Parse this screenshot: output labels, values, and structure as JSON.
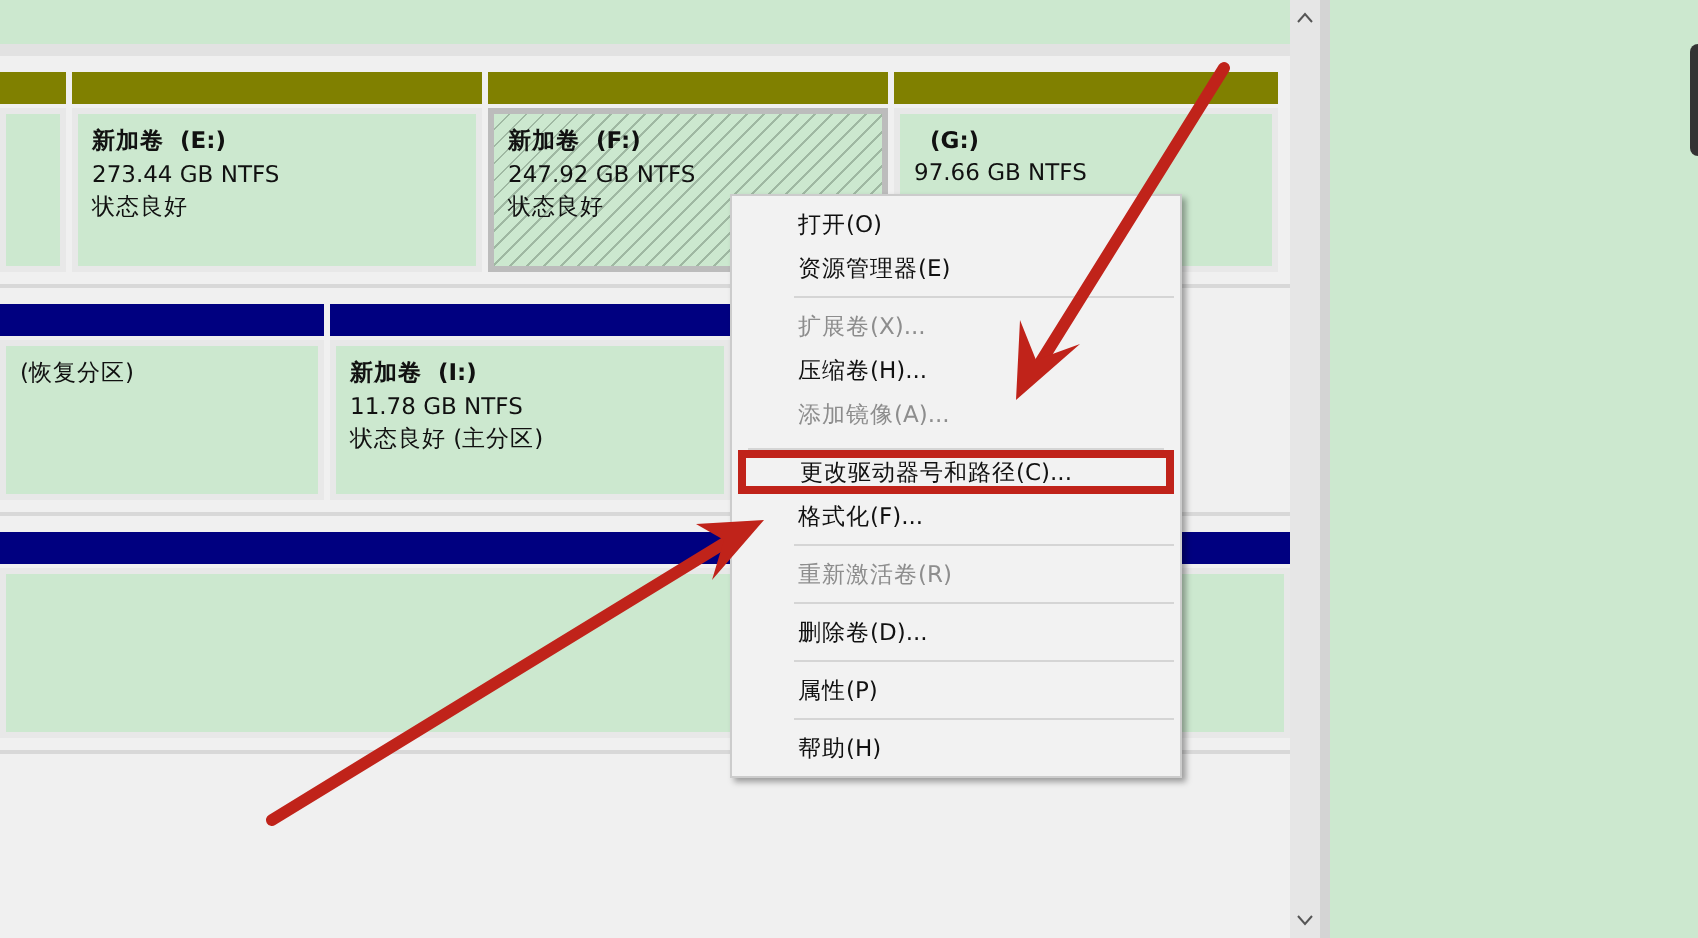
{
  "disks": [
    {
      "partitions": [
        {
          "kind": "logical",
          "selected": false
        },
        {
          "kind": "logical",
          "selected": false,
          "name": "新加卷  (E:)",
          "size": "273.44 GB NTFS",
          "status": "状态良好"
        },
        {
          "kind": "logical",
          "selected": true,
          "name": "新加卷  (F:)",
          "size": "247.92 GB NTFS",
          "status": "状态良好"
        },
        {
          "kind": "logical",
          "selected": false,
          "name": "  (G:)",
          "size": "97.66 GB NTFS"
        }
      ]
    },
    {
      "partitions": [
        {
          "kind": "primary",
          "selected": false,
          "status": "(恢复分区)"
        },
        {
          "kind": "primary",
          "selected": false,
          "name": "新加卷  (I:)",
          "size": "11.78 GB NTFS",
          "status": "状态良好 (主分区)"
        }
      ]
    },
    {
      "partitions": [
        {
          "kind": "primary",
          "selected": false
        }
      ]
    }
  ],
  "context_menu": [
    {
      "label": "打开(O)",
      "disabled": false,
      "separator_before": false,
      "highlighted": false
    },
    {
      "label": "资源管理器(E)",
      "disabled": false,
      "separator_before": false,
      "highlighted": false
    },
    {
      "label": "扩展卷(X)...",
      "disabled": true,
      "separator_before": true,
      "highlighted": false
    },
    {
      "label": "压缩卷(H)...",
      "disabled": false,
      "separator_before": false,
      "highlighted": false
    },
    {
      "label": "添加镜像(A)...",
      "disabled": true,
      "separator_before": false,
      "highlighted": false
    },
    {
      "label": "更改驱动器号和路径(C)...",
      "disabled": false,
      "separator_before": true,
      "highlighted": true
    },
    {
      "label": "格式化(F)...",
      "disabled": false,
      "separator_before": false,
      "highlighted": false
    },
    {
      "label": "重新激活卷(R)",
      "disabled": true,
      "separator_before": true,
      "highlighted": false
    },
    {
      "label": "删除卷(D)...",
      "disabled": false,
      "separator_before": true,
      "highlighted": false
    },
    {
      "label": "属性(P)",
      "disabled": false,
      "separator_before": true,
      "highlighted": false
    },
    {
      "label": "帮助(H)",
      "disabled": false,
      "separator_before": true,
      "highlighted": false
    }
  ]
}
